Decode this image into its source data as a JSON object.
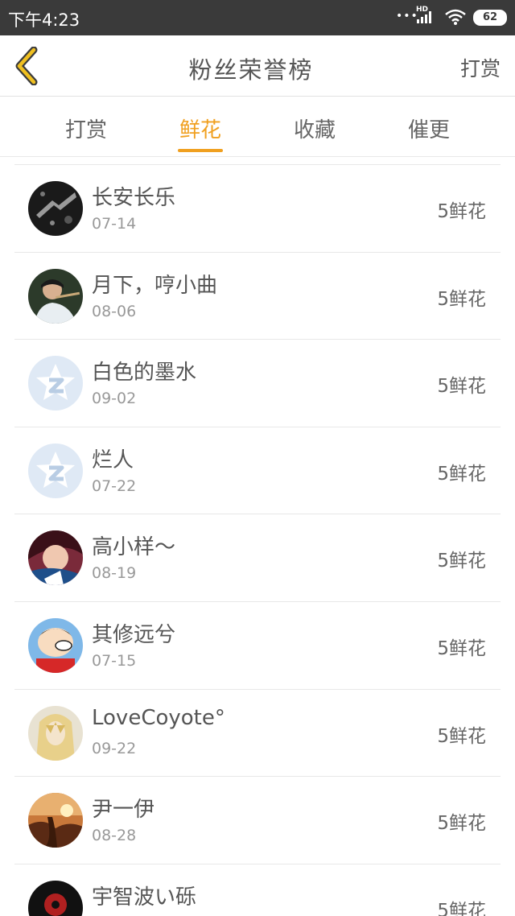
{
  "status_bar": {
    "time": "下午4:23",
    "network_label": "HD",
    "battery": "62"
  },
  "header": {
    "title": "粉丝荣誉榜",
    "action": "打赏",
    "back_icon": "chevron-left-icon",
    "accent_color": "#f0a020"
  },
  "tabs": [
    {
      "label": "打赏",
      "active": false
    },
    {
      "label": "鲜花",
      "active": true
    },
    {
      "label": "收藏",
      "active": false
    },
    {
      "label": "催更",
      "active": false
    }
  ],
  "fans": [
    {
      "name": "长安长乐",
      "date": "07-14",
      "count": "5鲜花",
      "avatar": "dark-photo"
    },
    {
      "name": "月下，哼小曲",
      "date": "08-06",
      "count": "5鲜花",
      "avatar": "flute-player-photo"
    },
    {
      "name": "白色的墨水",
      "date": "09-02",
      "count": "5鲜花",
      "avatar": "default-qzone-avatar"
    },
    {
      "name": "烂人",
      "date": "07-22",
      "count": "5鲜花",
      "avatar": "default-qzone-avatar"
    },
    {
      "name": "高小样～",
      "date": "08-19",
      "count": "5鲜花",
      "avatar": "portrait-photo"
    },
    {
      "name": "其修远兮",
      "date": "07-15",
      "count": "5鲜花",
      "avatar": "cartoon-avatar"
    },
    {
      "name": "LoveCoyote°",
      "date": "09-22",
      "count": "5鲜花",
      "avatar": "anime-avatar"
    },
    {
      "name": "尹一伊",
      "date": "08-28",
      "count": "5鲜花",
      "avatar": "sunset-photo"
    },
    {
      "name": "宇智波い砾",
      "date": "",
      "count": "5鲜花",
      "avatar": "anime-dark-avatar"
    }
  ]
}
